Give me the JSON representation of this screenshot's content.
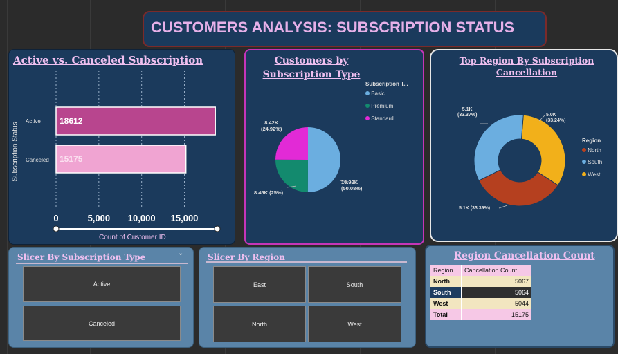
{
  "header": {
    "title": "CUSTOMERS ANALYSIS: SUBSCRIPTION STATUS"
  },
  "bar_panel": {
    "title": "Active vs. Canceled Subscription",
    "ylabel": "Subscription Status",
    "xlabel": "Count of Customer ID",
    "ticks": [
      "0",
      "5,000",
      "10,000",
      "15,000"
    ]
  },
  "pie_panel": {
    "title": "Customers by Subscription Type",
    "legend_title": "Subscription T...",
    "legend": [
      "Basic",
      "Premium",
      "Standard"
    ],
    "labels": {
      "standard": "8.42K",
      "standard_pct": "(24.92%)",
      "premium": "8.45K (25%)",
      "basic": "16.92K",
      "basic_pct": "(50.08%)"
    }
  },
  "donut_panel": {
    "title": "Top Region By Subscription Cancellation",
    "legend_title": "Region",
    "legend": [
      "North",
      "South",
      "West"
    ],
    "labels": {
      "south": "5.1K",
      "south_pct": "(33.37%)",
      "west": "5.0K",
      "west_pct": "(33.24%)",
      "north": "5.1K (33.39%)"
    }
  },
  "slicer_type": {
    "title": "Slicer By Subscription Type",
    "options": [
      "Active",
      "Canceled"
    ]
  },
  "slicer_region": {
    "title": "Slicer By Region",
    "options": [
      "East",
      "South",
      "North",
      "West"
    ]
  },
  "region_table": {
    "title": "Region Cancellation Count",
    "headers": [
      "Region",
      "Cancellation Count"
    ],
    "rows": [
      [
        "North",
        "5067"
      ],
      [
        "South",
        "5064"
      ],
      [
        "West",
        "5044"
      ]
    ],
    "total": [
      "Total",
      "15175"
    ]
  },
  "colors": {
    "basic": "#6baee0",
    "premium": "#138a6e",
    "standard": "#e22ad6",
    "north": "#b5401f",
    "south": "#6baee0",
    "west": "#f2b01a",
    "active_bar": "#b8458e",
    "canceled_bar": "#f0a4d2"
  },
  "chart_data": [
    {
      "type": "bar",
      "title": "Active vs. Canceled Subscription",
      "categories": [
        "Active",
        "Canceled"
      ],
      "values": [
        18612,
        15175
      ],
      "xlabel": "Count of Customer ID",
      "ylabel": "Subscription Status",
      "xlim": [
        0,
        19000
      ]
    },
    {
      "type": "pie",
      "title": "Customers by Subscription Type",
      "categories": [
        "Basic",
        "Premium",
        "Standard"
      ],
      "values": [
        16920,
        8450,
        8420
      ],
      "percent": [
        50.08,
        25,
        24.92
      ]
    },
    {
      "type": "pie",
      "title": "Top Region By Subscription Cancellation",
      "categories": [
        "North",
        "South",
        "West"
      ],
      "values": [
        5100,
        5100,
        5000
      ],
      "percent": [
        33.39,
        33.37,
        33.24
      ]
    }
  ]
}
